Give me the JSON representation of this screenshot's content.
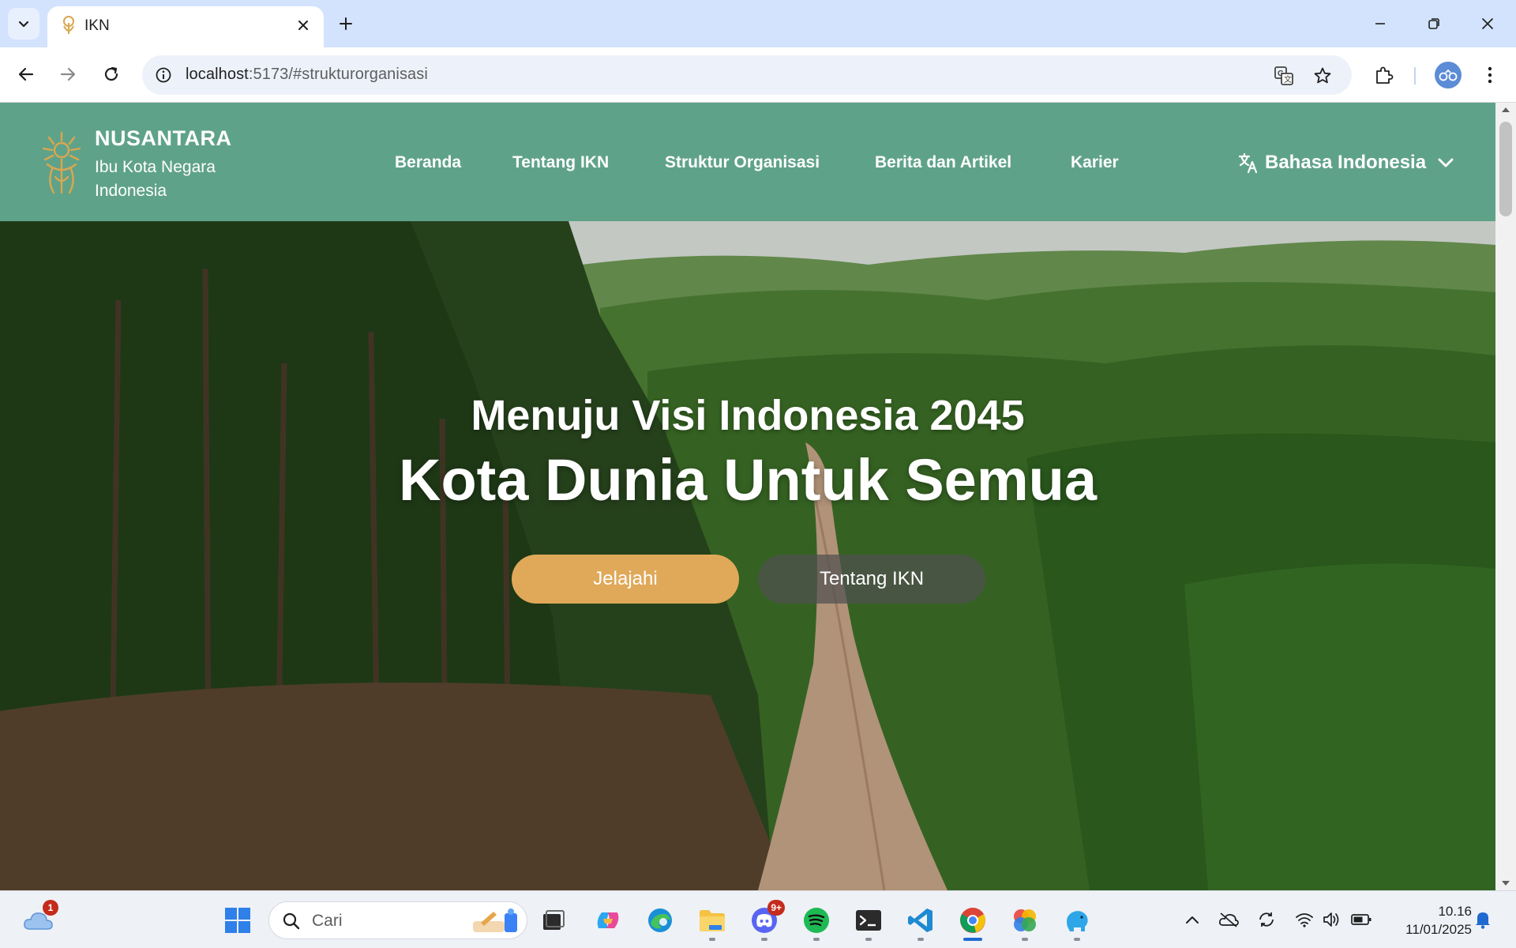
{
  "browser": {
    "tab_title": "IKN",
    "url_host": "localhost",
    "url_path": ":5173/#strukturorganisasi",
    "icons": [
      "tab-list-icon",
      "close-icon",
      "plus-icon",
      "minimize-icon",
      "restore-icon",
      "close-window-icon",
      "back-icon",
      "forward-icon",
      "reload-icon",
      "site-info-icon",
      "translate-icon",
      "star-icon",
      "extensions-icon",
      "profile-icon",
      "menu-dots-icon"
    ]
  },
  "header": {
    "brand_name": "NUSANTARA",
    "brand_sub": "Ibu Kota Negara Indonesia",
    "menu": [
      "Beranda",
      "Tentang IKN",
      "Struktur Organisasi",
      "Berita dan Artikel",
      "Karier"
    ],
    "language": "Bahasa Indonesia",
    "background_color": "#5fa28a",
    "logo_color": "#d9a74e"
  },
  "hero": {
    "kicker": "Menuju Visi Indonesia 2045",
    "title": "Kota Dunia Untuk Semua",
    "primary_button": "Jelajahi",
    "secondary_button": "Tentang IKN",
    "primary_color": "#e0a959"
  },
  "taskbar": {
    "search_placeholder": "Cari",
    "weather_badge": "1",
    "discord_badge": "9+",
    "apps": [
      "windows-start-icon",
      "search-icon",
      "task-view-icon",
      "copilot-icon",
      "edge-icon",
      "file-explorer-icon",
      "discord-icon",
      "spotify-icon",
      "terminal-icon",
      "vscode-icon",
      "chrome-icon",
      "photos-icon",
      "elephant-app-icon"
    ],
    "tray": [
      "chevron-up-icon",
      "onedrive-icon",
      "sync-icon",
      "wifi-icon",
      "volume-icon",
      "battery-icon",
      "notification-bell-icon"
    ],
    "time": "10.16",
    "date": "11/01/2025"
  }
}
